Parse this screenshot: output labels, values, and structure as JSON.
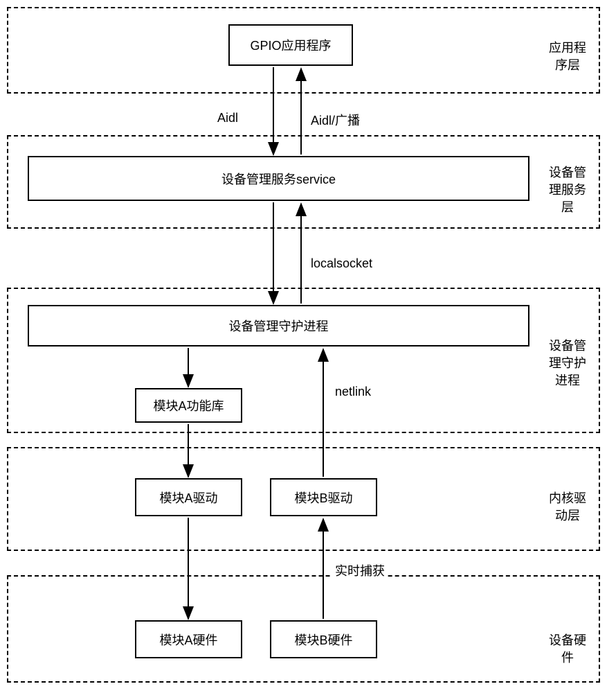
{
  "layers": {
    "app": {
      "label": "应用程序层"
    },
    "service": {
      "label": "设备管理服务层"
    },
    "daemon": {
      "label": "设备管理守护进程"
    },
    "kernel": {
      "label": "内核驱动层"
    },
    "hardware": {
      "label": "设备硬件"
    }
  },
  "boxes": {
    "gpio_app": "GPIO应用程序",
    "device_service": "设备管理服务service",
    "device_daemon": "设备管理守护进程",
    "module_a_lib": "模块A功能库",
    "module_a_driver": "模块A驱动",
    "module_b_driver": "模块B驱动",
    "module_a_hw": "模块A硬件",
    "module_b_hw": "模块B硬件"
  },
  "labels": {
    "aidl_down": "Aidl",
    "aidl_up": "Aidl/广播",
    "localsocket": "localsocket",
    "netlink": "netlink",
    "realtime": "实时捕获"
  }
}
